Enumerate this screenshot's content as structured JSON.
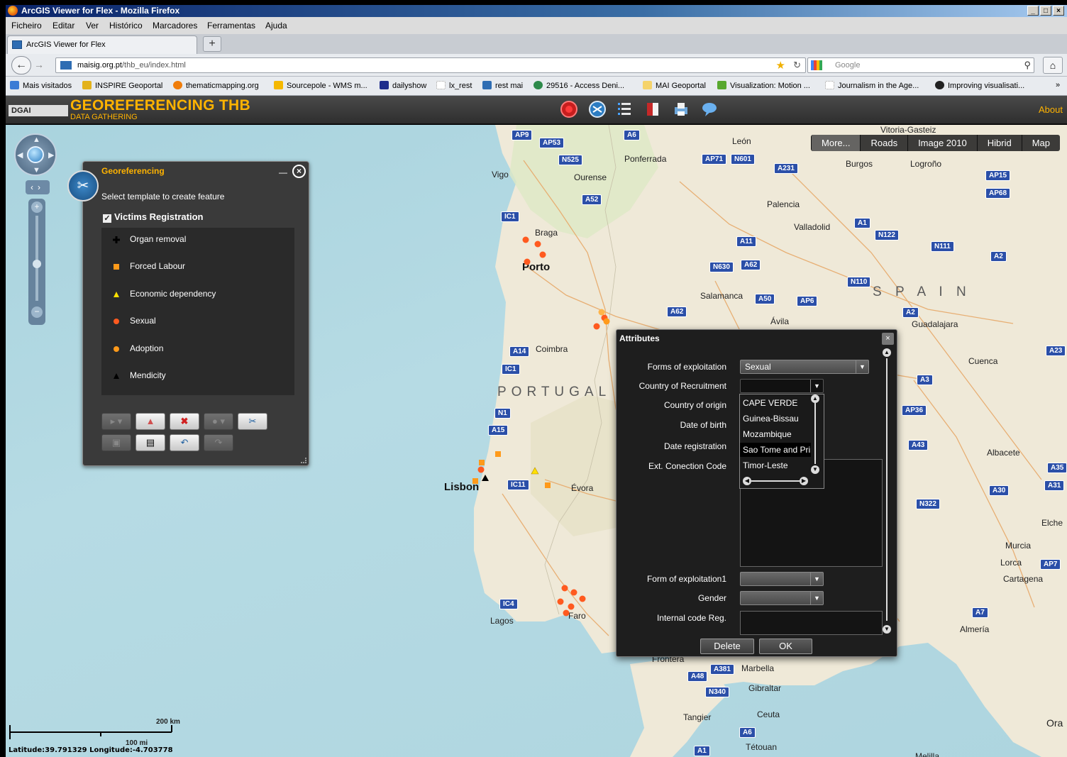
{
  "window": {
    "title": "ArcGIS Viewer for Flex - Mozilla Firefox",
    "controls": [
      "_",
      "□",
      "×"
    ]
  },
  "menu": [
    "Ficheiro",
    "Editar",
    "Ver",
    "Histórico",
    "Marcadores",
    "Ferramentas",
    "Ajuda"
  ],
  "tab": {
    "label": "ArcGIS Viewer for Flex",
    "new_tab": "+"
  },
  "nav": {
    "url_host": "maisig.org.pt",
    "url_path": "/thb_eu/index.html",
    "search_placeholder": "Google"
  },
  "bookmarks": [
    {
      "label": "Mais visitados",
      "color": "#3a7bd5"
    },
    {
      "label": "INSPIRE Geoportal",
      "color": "#e3b21b"
    },
    {
      "label": "thematicmapping.org",
      "color": "#f07d0a"
    },
    {
      "label": "Sourcepole - WMS m...",
      "color": "#f5b800"
    },
    {
      "label": "dailyshow",
      "color": "#1d2c8c"
    },
    {
      "label": "lx_rest",
      "color": "#cccccc"
    },
    {
      "label": "rest mai",
      "color": "#2f6db3"
    },
    {
      "label": "29516 - Access Deni...",
      "color": "#2d8a4a"
    },
    {
      "label": "MAI Geoportal",
      "color": "#f5d36b"
    },
    {
      "label": "Visualization: Motion ...",
      "color": "#58a82f"
    },
    {
      "label": "Journalism in the Age...",
      "color": "#cccccc"
    },
    {
      "label": "Improving visualisati...",
      "color": "#222222"
    }
  ],
  "app": {
    "logo_text": "DGAI",
    "title": "GEOREFERENCING THB",
    "subtitle": "DATA GATHERING",
    "about": "About",
    "accent": "#ffb300"
  },
  "basemaps": [
    "More...",
    "Roads",
    "Image 2010",
    "Hibrid",
    "Map"
  ],
  "georef": {
    "title": "Georeferencing",
    "hint": "Select template to create feature",
    "group": "Victims Registration",
    "items": [
      {
        "label": "Organ removal",
        "symbol": "cross",
        "color": "#000000"
      },
      {
        "label": "Forced Labour",
        "symbol": "square",
        "color": "#ff9a1a"
      },
      {
        "label": "Economic dependency",
        "symbol": "triangle",
        "color": "#ffe000"
      },
      {
        "label": "Sexual",
        "symbol": "circle",
        "color": "#ff5a1f"
      },
      {
        "label": "Adoption",
        "symbol": "circle",
        "color": "#ff9a1a"
      },
      {
        "label": "Mendicity",
        "symbol": "triangle",
        "color": "#000000"
      }
    ]
  },
  "attributes": {
    "title": "Attributes",
    "fields": [
      {
        "label": "Forms of exploitation",
        "value": "Sexual"
      },
      {
        "label": "Country of Recruitment",
        "value": ""
      },
      {
        "label": "Country of origin"
      },
      {
        "label": "Date of birth"
      },
      {
        "label": "Date registration"
      },
      {
        "label": "Ext. Conection Code"
      },
      {
        "label": "Form of exploitation1",
        "value": ""
      },
      {
        "label": "Gender",
        "value": ""
      },
      {
        "label": "Internal code Reg."
      }
    ],
    "dropdown_options": [
      "CAPE VERDE",
      "Guinea-Bissau",
      "Mozambique",
      "Sao Tome and Principe",
      "Timor-Leste"
    ],
    "selected_option": "Sao Tome and Principe",
    "delete_label": "Delete",
    "ok_label": "OK"
  },
  "map_labels": {
    "country_pt": "PORTUGAL",
    "country_es": "S P A I N",
    "cities": [
      "Vitoria-Gasteiz",
      "León",
      "Ponferrada",
      "Vigo",
      "Ourense",
      "Burgos",
      "Logroño",
      "Palencia",
      "Braga",
      "Valladolid",
      "Porto",
      "Salamanca",
      "Ávila",
      "Guadalajara",
      "Coimbra",
      "Cuenca",
      "Albacete",
      "Lisbon",
      "Évora",
      "Faro",
      "Lagos",
      "Murcia",
      "Lorca",
      "Cartagena",
      "Almería",
      "Marbella",
      "Gibraltar",
      "Tangier",
      "Ceuta",
      "Tétouan",
      "Elche",
      "Ora",
      "Melilla",
      "Frontera"
    ]
  },
  "scale": {
    "km": "200 km",
    "mi": "100 mi"
  },
  "coords": "Latitude:39.791329  Longitude:-4.703778"
}
